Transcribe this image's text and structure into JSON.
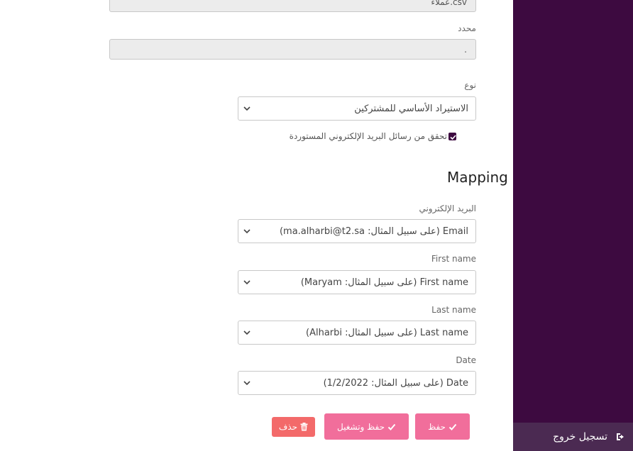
{
  "file": {
    "value": "عملاء.csv"
  },
  "delimiter": {
    "label": "محدد",
    "value": "."
  },
  "type": {
    "label": "نوع",
    "selected": "الاستيراد الأساسي للمشتركين"
  },
  "verify_emails": {
    "label": "تحقق من رسائل البريد الإلكتروني المستوردة",
    "checked": true
  },
  "mapping": {
    "title": "Mapping",
    "fields": [
      {
        "label": "البريد الإلكتروني",
        "selected": "Email (على سبيل المثال: ma.alharbi@t2.sa)"
      },
      {
        "label": "First name",
        "selected": "First name (على سبيل المثال: Maryam)"
      },
      {
        "label": "Last name",
        "selected": "Last name (على سبيل المثال: Alharbi)"
      },
      {
        "label": "Date",
        "selected": "Date (على سبيل المثال: 1/2/2022)"
      }
    ]
  },
  "buttons": {
    "save": "حفظ",
    "save_run": "حفظ وتشغيل",
    "delete": "حذف"
  },
  "sidebar": {
    "logout": "تسجيل خروج"
  },
  "colors": {
    "sidebar": "#3d0a40",
    "primary_button": "#f16e9b",
    "danger_button": "#f36a6a"
  }
}
